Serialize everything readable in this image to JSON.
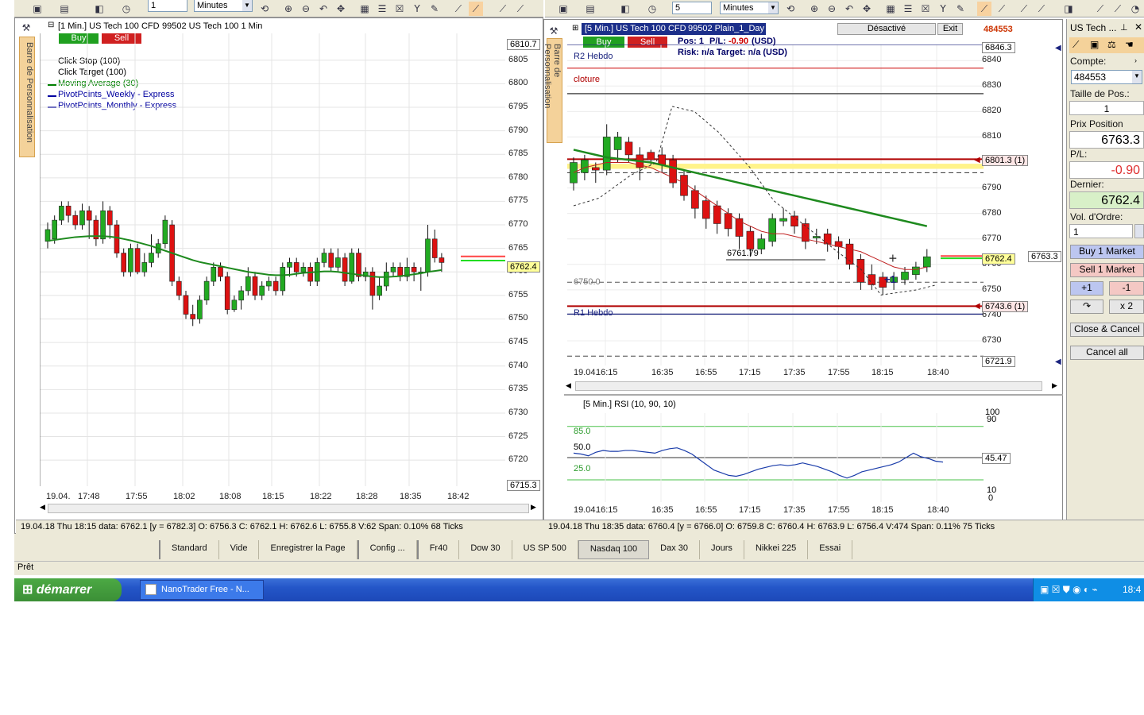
{
  "toolbar_left": {
    "interval_value": "1",
    "unit": "Minutes"
  },
  "toolbar_right": {
    "interval_value": "5",
    "unit": "Minutes"
  },
  "chart1": {
    "header": "[1 Min.] US Tech 100 CFD",
    "header2": "99502 US Tech 100 1 Min",
    "buy": "Buy",
    "sell": "Sell",
    "sidebar": "Barre de Personnalisation",
    "legend": [
      "Click Stop  (100)",
      "Click Target  (100)",
      "Moving Average  (30)",
      "PivotPoints_Weekly - Express",
      "PivotPoints_Monthly - Express"
    ],
    "legend_colors": [
      "#000000",
      "#000000",
      "#008000",
      "#0000a0",
      "#0000a0"
    ],
    "price_top": "6810.7",
    "price_bottom": "6715.3",
    "last_price": "6762.4",
    "yticks": [
      "6805",
      "6800",
      "6795",
      "6790",
      "6785",
      "6780",
      "6775",
      "6770",
      "6765",
      "6760",
      "6755",
      "6750",
      "6745",
      "6740",
      "6735",
      "6730",
      "6725",
      "6720"
    ],
    "date": "19.04.",
    "xticks": [
      "17:48",
      "17:55",
      "18:02",
      "18:08",
      "18:15",
      "18:22",
      "18:28",
      "18:35",
      "18:42"
    ],
    "status": "19.04.18 Thu  18:15 data: 6762.1 [y = 6782.3]     O: 6756.3 C: 6762.1 H: 6762.6 L: 6755.8 V:62 Span: 0.10% 68 Ticks"
  },
  "chart2": {
    "header": "[5 Min.] US Tech 100 CFD",
    "header2": "99502 Plain_1_Day",
    "desactive": "Désactivé",
    "exit": "Exit",
    "account": "484553",
    "buy": "Buy",
    "sell": "Sell",
    "pos": "Pos: 1",
    "pl_label": "P/L:",
    "pl_value": "-0.90",
    "currency": "(USD)",
    "risk": "Risk: n/a  Target: n/a (USD)",
    "sidebar": "Barre de Personnalisation",
    "r2": "R2 Hebdo",
    "cloture": "cloture",
    "r1": "R1 Hebdo",
    "level_6750": "6750.0",
    "level_6761": "6761.79",
    "plus_one": "+1",
    "price_top": "6846.3",
    "price_6801": "6801.3 (1)",
    "price_6743": "6743.6 (1)",
    "price_last": "6762.4",
    "price_pos": "6763.3",
    "price_bottom": "6721.9",
    "yticks": [
      "6840",
      "6830",
      "6820",
      "6810",
      "6790",
      "6780",
      "6770",
      "6760",
      "6750",
      "6740",
      "6730"
    ],
    "date": "19.04.",
    "xticks": [
      "16:15",
      "16:35",
      "16:55",
      "17:15",
      "17:35",
      "17:55",
      "18:15",
      "18:40"
    ],
    "rsi_header": "[5 Min.] RSI  (10, 90, 10)",
    "rsi_100": "100",
    "rsi_90": "90",
    "rsi_85": "85.0",
    "rsi_50": "50.0",
    "rsi_25": "25.0",
    "rsi_10": "10",
    "rsi_0": "0",
    "rsi_value": "45.47",
    "status": "19.04.18 Thu  18:35 data: 6760.4 [y = 6766.0]     O: 6759.8 C: 6760.4 H: 6763.9 L: 6756.4 V:474 Span: 0.11% 75 Ticks"
  },
  "right_panel": {
    "title": "US Tech ...",
    "compte_label": "Compte:",
    "compte_value": "484553",
    "taille_label": "Taille de Pos.:",
    "taille_value": "1",
    "prix_label": "Prix Position",
    "prix_value": "6763.3",
    "pl_label": "P/L:",
    "pl_value": "-0.90",
    "dernier_label": "Dernier:",
    "dernier_value": "6762.4",
    "vol_label": "Vol. d'Ordre:",
    "vol_value": "1",
    "buy_market": "Buy 1 Market",
    "sell_market": "Sell 1 Market",
    "plus1": "+1",
    "minus1": "-1",
    "x2": "x 2",
    "close_cancel": "Close & Cancel",
    "cancel_all": "Cancel all"
  },
  "tabs": [
    "Standard",
    "Vide",
    "Enregistrer la Page",
    "Config ...",
    "Fr40",
    "Dow 30",
    "US SP 500",
    "Nasdaq 100",
    "Dax 30",
    "Jours",
    "Nikkei 225",
    "Essai"
  ],
  "active_tab": "Nasdaq 100",
  "status_bar": "Prêt",
  "taskbar": {
    "start": "démarrer",
    "item": "NanoTrader Free - N...",
    "clock": "18:4"
  },
  "colors": {
    "up": "#22aa22",
    "down": "#dd1111",
    "ma": "#1e8a1e",
    "buy": "#20a020",
    "sell": "#d02020"
  }
}
